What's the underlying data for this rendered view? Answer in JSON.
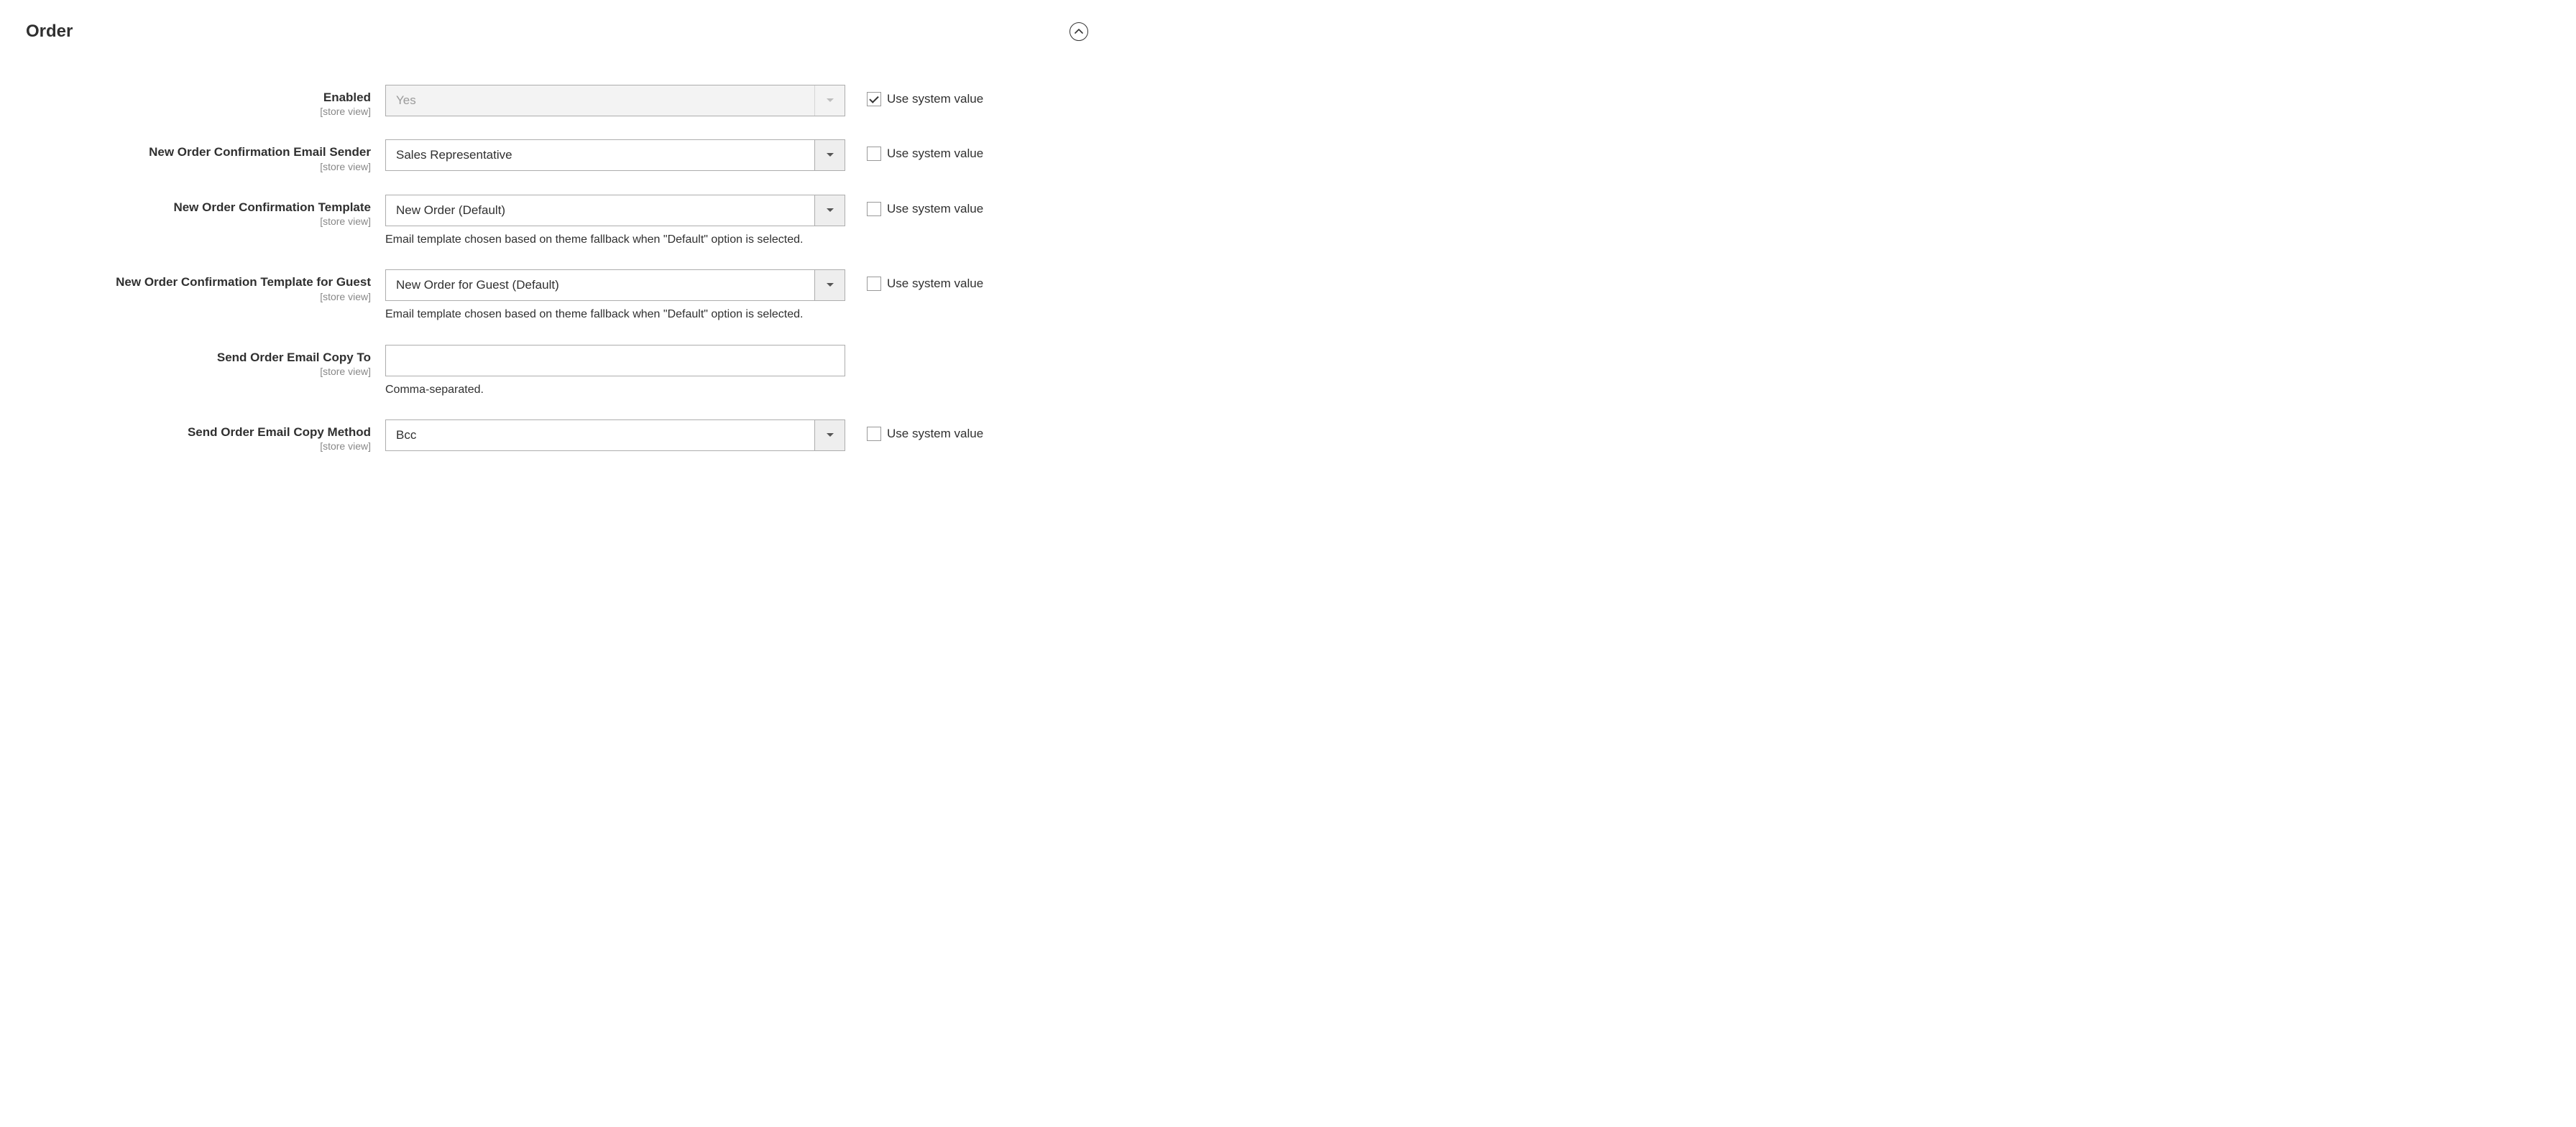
{
  "section": {
    "title": "Order"
  },
  "common": {
    "use_system_value": "Use system value",
    "scope_store_view": "[store view]"
  },
  "fields": {
    "enabled": {
      "label": "Enabled",
      "value": "Yes",
      "use_system": true
    },
    "sender": {
      "label": "New Order Confirmation Email Sender",
      "value": "Sales Representative",
      "use_system": false
    },
    "template": {
      "label": "New Order Confirmation Template",
      "value": "New Order (Default)",
      "note": "Email template chosen based on theme fallback when \"Default\" option is selected.",
      "use_system": false
    },
    "template_guest": {
      "label": "New Order Confirmation Template for Guest",
      "value": "New Order for Guest (Default)",
      "note": "Email template chosen based on theme fallback when \"Default\" option is selected.",
      "use_system": false
    },
    "copy_to": {
      "label": "Send Order Email Copy To",
      "value": "",
      "note": "Comma-separated."
    },
    "copy_method": {
      "label": "Send Order Email Copy Method",
      "value": "Bcc",
      "use_system": false
    }
  }
}
